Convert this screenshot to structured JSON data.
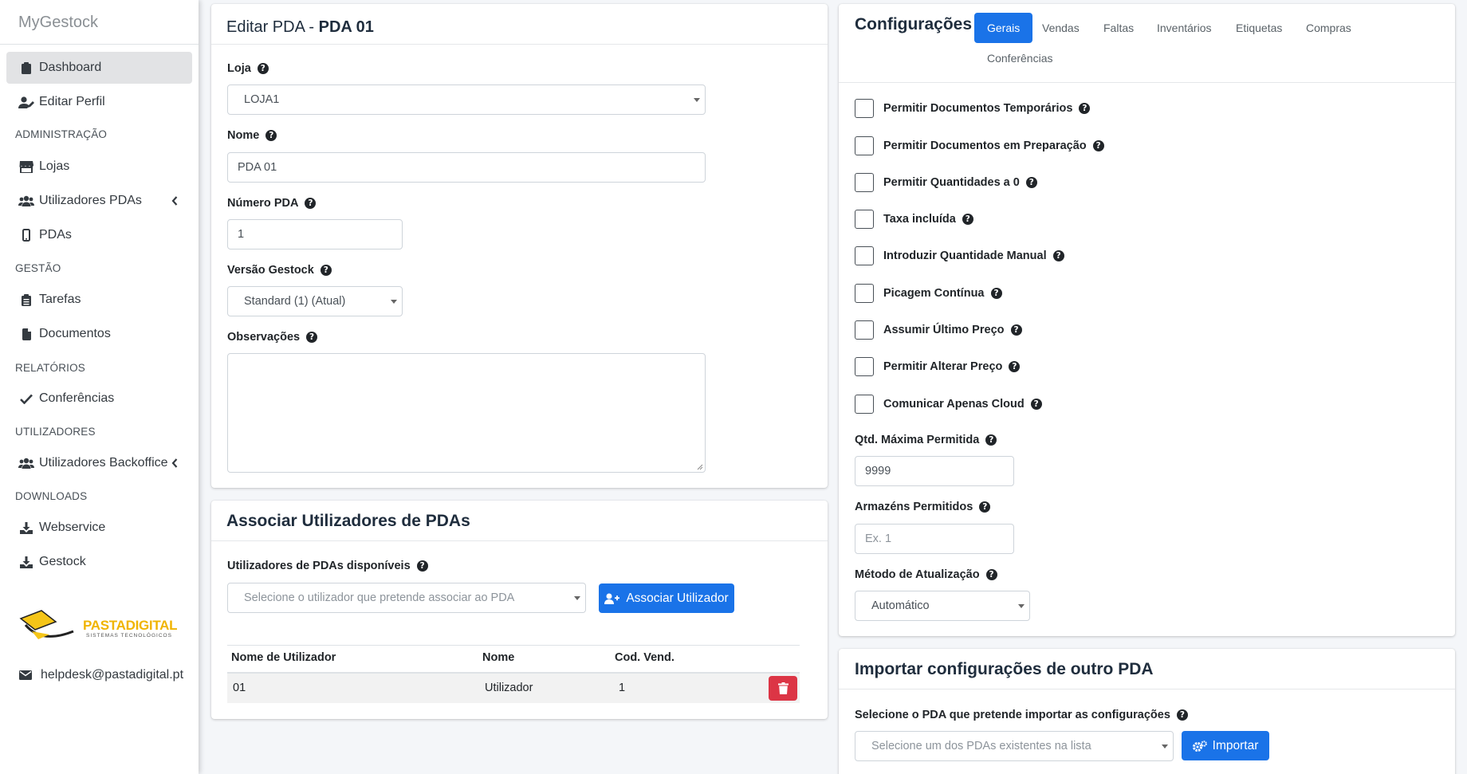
{
  "brand": "MyGestock",
  "sidebar": {
    "dashboard": "Dashboard",
    "editar_perfil": "Editar Perfil",
    "h_admin": "ADMINISTRAÇÃO",
    "lojas": "Lojas",
    "utilizadores_pdas": "Utilizadores PDAs",
    "pdas": "PDAs",
    "h_gestao": "GESTÃO",
    "tarefas": "Tarefas",
    "documentos": "Documentos",
    "h_relatorios": "RELATÓRIOS",
    "conferencias": "Conferências",
    "h_utilizadores": "UTILIZADORES",
    "utilizadores_backoffice": "Utilizadores Backoffice",
    "h_downloads": "DOWNLOADS",
    "webservice": "Webservice",
    "gestock": "Gestock",
    "logo_main": "PASTADIGITAL",
    "logo_sub": "SISTEMAS TECNOLÓGICOS",
    "helpdesk": "helpdesk@pastadigital.pt"
  },
  "edit": {
    "title_prefix": "Editar PDA - ",
    "title_name": "PDA 01",
    "loja_label": "Loja",
    "loja_value": "LOJA1",
    "nome_label": "Nome",
    "nome_value": "PDA 01",
    "numero_label": "Número PDA",
    "numero_value": "1",
    "versao_label": "Versão Gestock",
    "versao_value": "Standard (1) (Atual)",
    "obs_label": "Observações"
  },
  "assoc": {
    "title": "Associar Utilizadores de PDAs",
    "disp_label": "Utilizadores de PDAs disponíveis",
    "select_placeholder": "Selecione o utilizador que pretende associar ao PDA",
    "button": "Associar Utilizador",
    "columns": [
      "Nome de Utilizador",
      "Nome",
      "Cod. Vend."
    ],
    "row": {
      "user": "01",
      "name": "Utilizador",
      "cod": "1"
    }
  },
  "config": {
    "title": "Configurações",
    "tabs": [
      "Gerais",
      "Vendas",
      "Faltas",
      "Inventários",
      "Etiquetas",
      "Compras",
      "Conferências"
    ],
    "checkboxes": [
      "Permitir Documentos Temporários",
      "Permitir Documentos em Preparação",
      "Permitir Quantidades a 0",
      "Taxa incluída",
      "Introduzir Quantidade Manual",
      "Picagem Contínua",
      "Assumir Último Preço",
      "Permitir Alterar Preço",
      "Comunicar Apenas Cloud"
    ],
    "qtd_label": "Qtd. Máxima Permitida",
    "qtd_value": "9999",
    "armazens_label": "Armazéns Permitidos",
    "armazens_placeholder": "Ex. 1",
    "metodo_label": "Método de Atualização",
    "metodo_value": "Automático"
  },
  "import": {
    "title": "Importar configurações de outro PDA",
    "label": "Selecione o PDA que pretende importar as configurações",
    "placeholder": "Selecione um dos PDAs existentes na lista",
    "button": "Importar"
  },
  "colors": {
    "accent": "#1a73e8",
    "danger": "#dc3545",
    "active_nav": "#e2e3e5"
  }
}
